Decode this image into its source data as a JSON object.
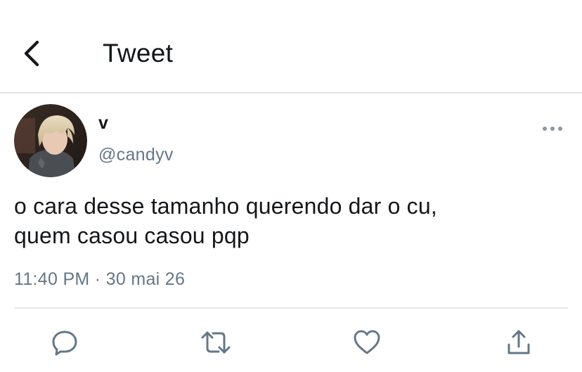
{
  "header": {
    "title": "Tweet",
    "back_icon": "chevron-left-icon"
  },
  "tweet": {
    "author": {
      "display_name": "v",
      "handle": "@candyv"
    },
    "text": "o cara desse tamanho querendo dar o cu,\nquem casou casou pqp",
    "timestamp": "11:40 PM · 30 mai 26"
  },
  "actions": [
    {
      "icon": "reply-icon"
    },
    {
      "icon": "retweet-icon"
    },
    {
      "icon": "like-icon"
    },
    {
      "icon": "share-icon"
    }
  ],
  "colors": {
    "text_primary": "#14171a",
    "text_secondary": "#657786",
    "icon_gray": "#657786",
    "divider": "#e1e4e7"
  }
}
